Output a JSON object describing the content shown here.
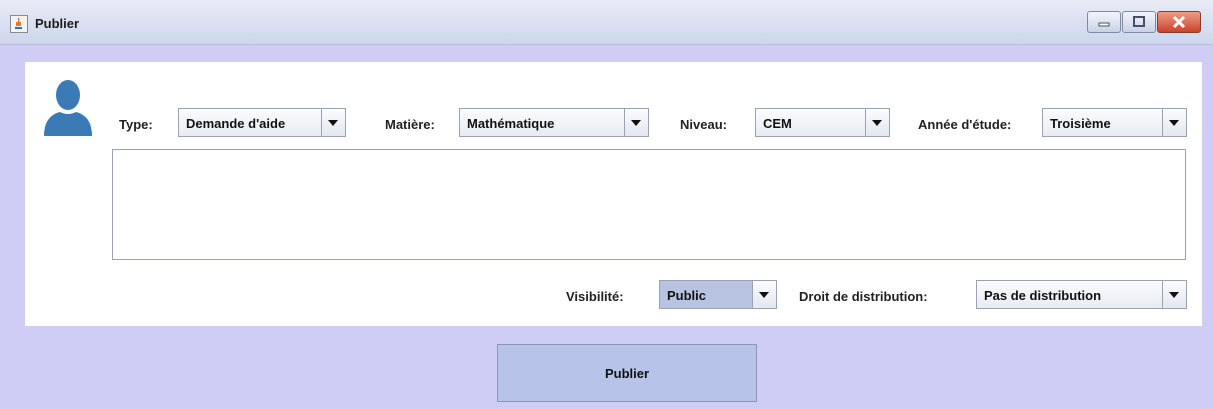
{
  "window": {
    "title": "Publier",
    "icon": "java-cup-icon"
  },
  "window_controls": [
    "minimize-icon",
    "maximize-icon",
    "close-icon"
  ],
  "form": {
    "type": {
      "label": "Type:",
      "value": "Demande d'aide"
    },
    "matiere": {
      "label": "Matière:",
      "value": "Mathématique"
    },
    "niveau": {
      "label": "Niveau:",
      "value": "CEM"
    },
    "annee": {
      "label": "Année d'étude:",
      "value": "Troisième"
    },
    "content": {
      "value": ""
    },
    "visibilite": {
      "label": "Visibilité:",
      "value": "Public"
    },
    "droit": {
      "label": "Droit de distribution:",
      "value": "Pas de distribution"
    }
  },
  "actions": {
    "publish_label": "Publier"
  },
  "colors": {
    "background": "#cfcdf6",
    "panel": "#ffffff",
    "button": "#b7c3e9",
    "avatar": "#3a7bb5",
    "selected_combo": "#b7c3e0"
  }
}
